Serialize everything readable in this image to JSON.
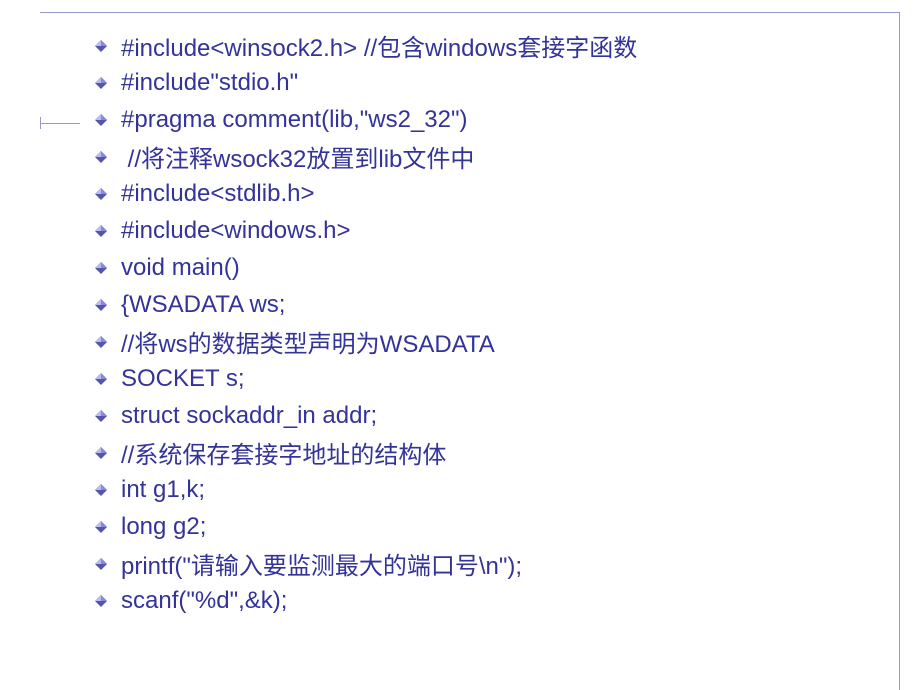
{
  "lines": [
    "#include<winsock2.h> //包含windows套接字函数",
    "#include\"stdio.h\"",
    "#pragma comment(lib,\"ws2_32\")",
    " //将注释wsock32放置到lib文件中",
    "#include<stdlib.h>",
    "#include<windows.h>",
    "void main()",
    "{WSADATA ws;",
    "//将ws的数据类型声明为WSADATA",
    "SOCKET s;",
    "struct sockaddr_in addr;",
    "//系统保存套接字地址的结构体",
    "int g1,k;",
    "long g2;",
    "printf(\"请输入要监测最大的端口号\\n\");",
    "scanf(\"%d\",&k);"
  ],
  "colors": {
    "text": "#333399",
    "bullet_fill": "#6666cc",
    "bullet_highlight": "#ccccff",
    "border": "#9999cc"
  }
}
